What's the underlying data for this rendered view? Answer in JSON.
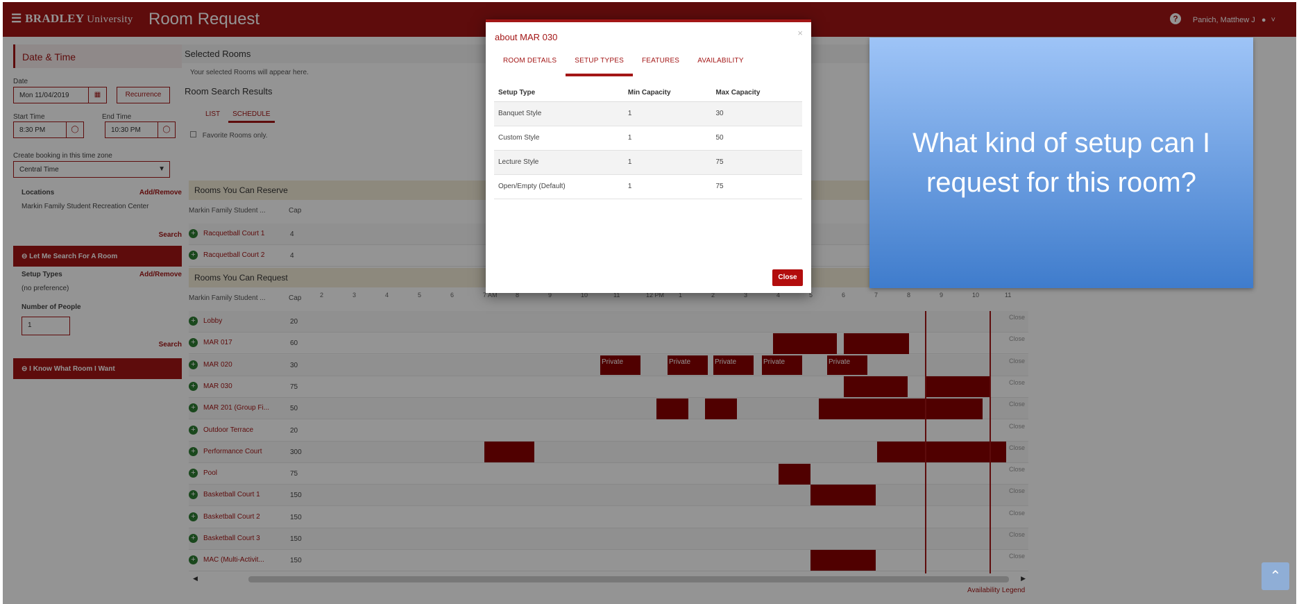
{
  "header": {
    "logo": "BRADLEY",
    "logo_suffix": "University",
    "app_title": "Room Request",
    "help_icon": "?",
    "user_name": "Panich, Matthew J"
  },
  "left_panel": {
    "title": "Date & Time",
    "date_label": "Date",
    "date_value": "Mon 11/04/2019",
    "recurrence_label": "Recurrence",
    "start_label": "Start Time",
    "start_value": "8:30 PM",
    "end_label": "End Time",
    "end_value": "10:30 PM",
    "timezone_label": "Create booking in this time zone",
    "timezone_value": "Central Time",
    "locations_label": "Locations",
    "add_remove": "Add/Remove",
    "location_value": "Markin Family Student Recreation Center",
    "search_label": "Search",
    "let_me_search": "Let Me Search For A Room",
    "setup_types_label": "Setup Types",
    "setup_types_value": "(no preference)",
    "people_label": "Number of People",
    "people_value": "1",
    "i_know": "I Know What Room I Want"
  },
  "results": {
    "selected_title": "Selected Rooms",
    "selected_note": "Your selected Rooms will appear here.",
    "search_title": "Room Search Results",
    "view_tabs": [
      "LIST",
      "SCHEDULE"
    ],
    "favorites_label": "Favorite Rooms only.",
    "reserve_group": "Rooms You Can Reserve",
    "request_group": "Rooms You Can Request",
    "col_building": "Markin Family Student ...",
    "col_cap": "Cap",
    "closed_label": "Close",
    "availability_legend": "Availability Legend",
    "hours_left": [
      "2",
      "3",
      "4",
      "5",
      "6",
      "7"
    ],
    "hours_right": [
      "6",
      "7",
      "8",
      "9",
      "10",
      "11"
    ],
    "request_hours": [
      "2",
      "3",
      "4",
      "5",
      "6",
      "7 AM",
      "8",
      "9",
      "10",
      "11",
      "12 PM",
      "1",
      "2",
      "3",
      "4",
      "5",
      "6",
      "7",
      "8",
      "9",
      "10",
      "11"
    ],
    "reserve_rooms": [
      {
        "name": "Racquetball Court 1",
        "cap": "4"
      },
      {
        "name": "Racquetball Court 2",
        "cap": "4"
      }
    ],
    "request_rooms": [
      {
        "name": "Lobby",
        "cap": "20"
      },
      {
        "name": "MAR 017",
        "cap": "60"
      },
      {
        "name": "MAR 020",
        "cap": "30"
      },
      {
        "name": "MAR 030",
        "cap": "75"
      },
      {
        "name": "MAR 201 (Group Fi...",
        "cap": "50"
      },
      {
        "name": "Outdoor Terrace",
        "cap": "20"
      },
      {
        "name": "Performance Court",
        "cap": "300"
      },
      {
        "name": "Pool",
        "cap": "75"
      },
      {
        "name": "Basketball Court 1",
        "cap": "150"
      },
      {
        "name": "Basketball Court 2",
        "cap": "150"
      },
      {
        "name": "Basketball Court 3",
        "cap": "150"
      },
      {
        "name": "MAC (Multi-Activit...",
        "cap": "150"
      }
    ],
    "private_label": "Private"
  },
  "modal": {
    "title": "about MAR 030",
    "close_x": "×",
    "tabs": [
      "ROOM DETAILS",
      "SETUP TYPES",
      "FEATURES",
      "AVAILABILITY"
    ],
    "active_tab": "SETUP TYPES",
    "columns": [
      "Setup Type",
      "Min Capacity",
      "Max Capacity"
    ],
    "rows": [
      {
        "type": "Banquet Style",
        "min": "1",
        "max": "30"
      },
      {
        "type": "Custom Style",
        "min": "1",
        "max": "50"
      },
      {
        "type": "Lecture Style",
        "min": "1",
        "max": "75"
      },
      {
        "type": "Open/Empty (Default)",
        "min": "1",
        "max": "75"
      }
    ],
    "close_label": "Close"
  },
  "callout": {
    "text": "What kind of setup can I request for this room?"
  },
  "colors": {
    "brand": "#a31616",
    "booking": "#8b0000",
    "callout_top": "#9ec4f7",
    "callout_bottom": "#3f7ccc"
  }
}
